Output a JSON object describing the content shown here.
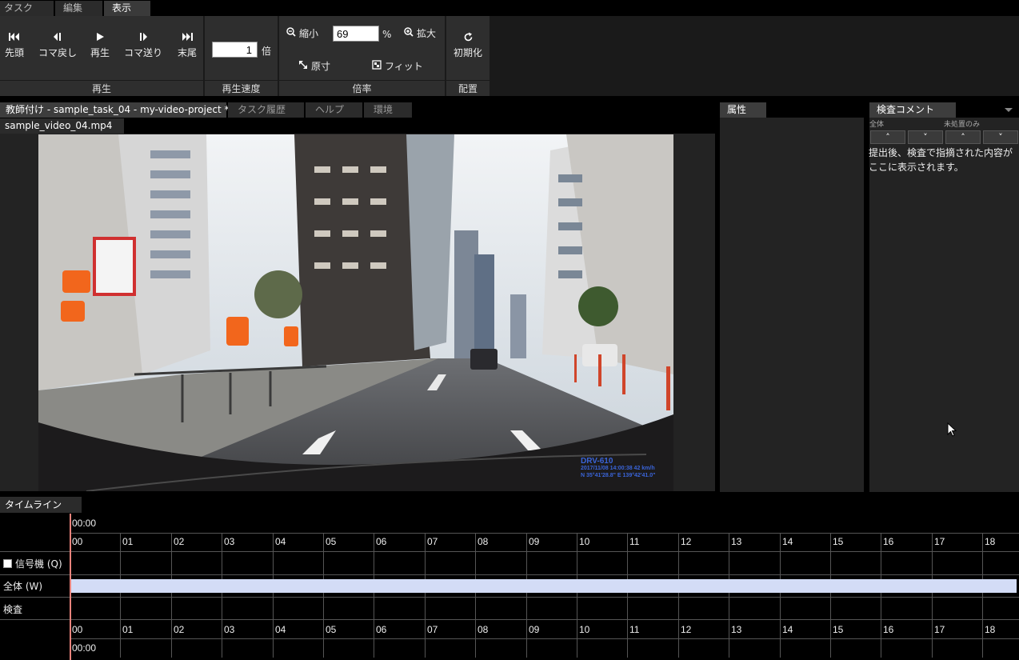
{
  "menu": {
    "tabs": [
      {
        "label": "タスク",
        "active": false
      },
      {
        "label": "編集",
        "active": false
      },
      {
        "label": "表示",
        "active": true
      }
    ]
  },
  "ribbon": {
    "playback": {
      "group_label": "再生",
      "buttons": [
        {
          "label": "先頭",
          "icon": "skip-to-start-icon"
        },
        {
          "label": "コマ戻し",
          "icon": "step-back-icon"
        },
        {
          "label": "再生",
          "icon": "play-icon"
        },
        {
          "label": "コマ送り",
          "icon": "step-forward-icon"
        },
        {
          "label": "末尾",
          "icon": "skip-to-end-icon"
        }
      ]
    },
    "speed": {
      "group_label": "再生速度",
      "value": "1",
      "suffix": "倍"
    },
    "zoom": {
      "group_label": "倍率",
      "zoom_out": "縮小",
      "value": "69",
      "suffix": "%",
      "zoom_in": "拡大",
      "actual_size": "原寸",
      "fit": "フィット"
    },
    "layout": {
      "group_label": "配置",
      "reset": "初期化"
    }
  },
  "main_tabs": [
    {
      "label": "教師付け - sample_task_04 - my-video-project *",
      "active": true
    },
    {
      "label": "タスク履歴",
      "active": false
    },
    {
      "label": "ヘルプ",
      "active": false
    },
    {
      "label": "環境",
      "active": false
    }
  ],
  "video": {
    "file_tab": "sample_video_04.mp4",
    "overlay_model": "DRV-610",
    "overlay_line1": "2017/11/08 14:00:38  42 km/h",
    "overlay_line2": "N 35°41'28.8\"  E 139°42'41.0\""
  },
  "attributes": {
    "tab": "属性"
  },
  "inspection": {
    "tab": "検査コメント",
    "filter_all": "全体",
    "filter_unresolved": "未処置のみ",
    "placeholder_text": "提出後、検査で指摘された内容がここに表示されます。"
  },
  "timeline": {
    "tab": "タイムライン",
    "time_top": "00:00",
    "time_bottom": "00:00",
    "ticks": [
      "00",
      "01",
      "02",
      "03",
      "04",
      "05",
      "06",
      "07",
      "08",
      "09",
      "10",
      "11",
      "12",
      "13",
      "14",
      "15",
      "16",
      "17",
      "18"
    ],
    "rows": [
      {
        "label": "信号機 (Q)",
        "checkbox": true
      },
      {
        "label": "全体 (W)",
        "checkbox": false
      },
      {
        "label": "検査",
        "checkbox": false
      }
    ]
  },
  "colors": {
    "cursor": "#e8837c",
    "whole_bar": "#d3dcf6"
  }
}
